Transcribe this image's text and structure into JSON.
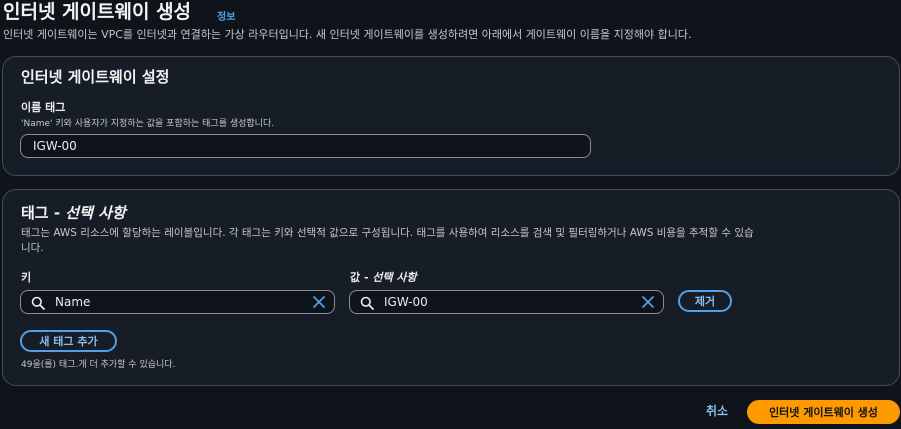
{
  "header": {
    "title": "인터넷 게이트웨이 생성",
    "info_link": "정보",
    "description": "인터넷 게이트웨이는 VPC를 인터넷과 연결하는 가상 라우터입니다. 새 인터넷 게이트웨이를 생성하려면 아래에서 게이트웨이 이름을 지정해야 합니다."
  },
  "settings": {
    "title": "인터넷 게이트웨이 설정",
    "name_tag_label": "이름 태그",
    "name_tag_desc": "'Name' 키와 사용자가 지정하는 값을 포함하는 태그를 생성합니다.",
    "name_tag_value": "IGW-00"
  },
  "tags": {
    "title_main": "태그 - ",
    "title_optional": "선택 사항",
    "desc_line1": "태그는 AWS 리소스에 할당하는 레이블입니다. 각 태그는 키와 선택적 값으로 구성됩니다. 태그를 사용하여 리소스를 검색 및 필터링하거나 AWS 비용을 추적할 수 있습",
    "desc_line2": "니다.",
    "key_label": "키",
    "value_label_main": "값 - ",
    "value_label_optional": "선택 사항",
    "rows": [
      {
        "key": "Name",
        "value": "IGW-00",
        "remove_label": "제거"
      }
    ],
    "add_button": "새 태그 추가",
    "remaining_hint": "49을(를) 태그.개 더 추가할 수 있습니다."
  },
  "footer": {
    "cancel": "취소",
    "submit": "인터넷 게이트웨이 생성"
  },
  "colors": {
    "background": "#0f141a",
    "card": "#161d26",
    "link": "#539fe5",
    "primary": "#ff9900"
  },
  "icons": [
    "search-icon",
    "close-icon"
  ]
}
